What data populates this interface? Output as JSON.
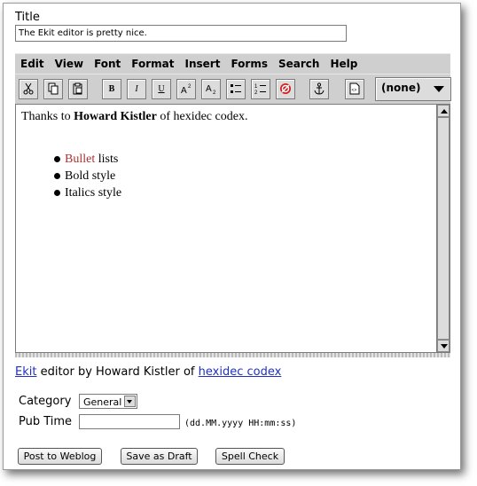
{
  "title_field": {
    "label": "Title",
    "value": "The Ekit editor is pretty nice."
  },
  "menu": [
    "Edit",
    "View",
    "Font",
    "Format",
    "Insert",
    "Forms",
    "Search",
    "Help"
  ],
  "toolbar": {
    "buttons": [
      "cut-icon",
      "copy-icon",
      "paste-icon",
      "bold-icon",
      "italic-icon",
      "underline-icon",
      "superscript-icon",
      "subscript-icon",
      "unordered-list-icon",
      "ordered-list-icon",
      "clear-format-icon",
      "anchor-icon",
      "source-view-icon"
    ],
    "bold_label": "B",
    "italic_label": "I",
    "underline_label": "U",
    "style_combo": "(none)"
  },
  "editor": {
    "intro_before": "Thanks to ",
    "intro_bold": "Howard Kistler",
    "intro_after": " of hexidec codex.",
    "bullets": [
      {
        "red": "Bullet",
        "rest": " lists"
      },
      {
        "red": "",
        "rest": "Bold style"
      },
      {
        "red": "",
        "rest": "Italics style"
      }
    ],
    "red_color": "#b03030"
  },
  "credit": {
    "link1": "Ekit",
    "middle": " editor by Howard Kistler of ",
    "link2": "hexidec codex"
  },
  "category": {
    "label": "Category",
    "value": "General"
  },
  "pubtime": {
    "label": "Pub Time",
    "value": "",
    "hint": "(dd.MM.yyyy HH:mm:ss)"
  },
  "buttons": {
    "post": "Post to Weblog",
    "draft": "Save as Draft",
    "spell": "Spell Check"
  }
}
